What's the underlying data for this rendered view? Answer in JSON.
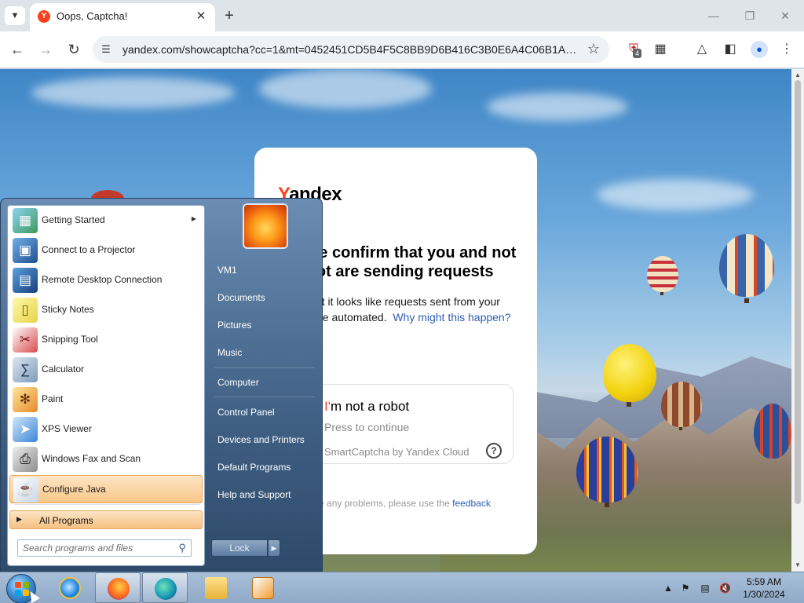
{
  "browser": {
    "tab_title": "Oops, Captcha!",
    "tab_favicon_letter": "Y",
    "url": "yandex.com/showcaptcha?cc=1&mt=0452451CD5B4F5C8BB9D6B416C3B0E6A4C06B1A64C...",
    "extension_badge": "4"
  },
  "captcha_page": {
    "brand_first": "Y",
    "brand_rest": "andex",
    "heading": "Please confirm that you and not a robot are sending requests",
    "description": "Sorry, but it looks like requests sent from your device are automated.",
    "why_link": "Why might this happen?",
    "robot_label": "I'm not a robot",
    "press_label": "Press to continue",
    "smartcaptcha_label": "SmartCaptcha by Yandex Cloud",
    "help_icon_label": "?",
    "footer_text": "If you have any problems, please use the",
    "footer_link": "feedback"
  },
  "start_menu": {
    "programs": [
      {
        "label": "Getting Started",
        "icon": "getting-started-icon",
        "has_arrow": true
      },
      {
        "label": "Connect to a Projector",
        "icon": "projector-icon"
      },
      {
        "label": "Remote Desktop Connection",
        "icon": "remote-desktop-icon"
      },
      {
        "label": "Sticky Notes",
        "icon": "sticky-notes-icon"
      },
      {
        "label": "Snipping Tool",
        "icon": "snipping-tool-icon"
      },
      {
        "label": "Calculator",
        "icon": "calculator-icon"
      },
      {
        "label": "Paint",
        "icon": "paint-icon"
      },
      {
        "label": "XPS Viewer",
        "icon": "xps-viewer-icon"
      },
      {
        "label": "Windows Fax and Scan",
        "icon": "fax-scan-icon"
      },
      {
        "label": "Configure Java",
        "icon": "java-icon",
        "highlighted": true
      }
    ],
    "all_programs": "All Programs",
    "search_placeholder": "Search programs and files",
    "right_links": [
      "VM1",
      "Documents",
      "Pictures",
      "Music",
      "Computer",
      "Control Panel",
      "Devices and Printers",
      "Default Programs",
      "Help and Support"
    ],
    "lock_label": "Lock"
  },
  "taskbar": {
    "time": "5:59 AM",
    "date": "1/30/2024"
  },
  "colors": {
    "yandex_red": "#fc3f1d",
    "link_blue": "#2f5cb3",
    "start_highlight": "#f9c789"
  }
}
